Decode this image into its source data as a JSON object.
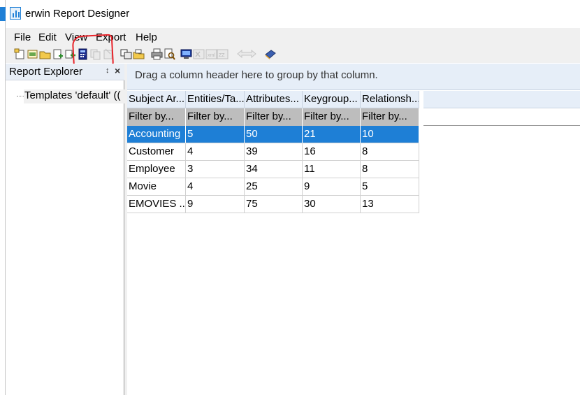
{
  "window": {
    "title": "erwin Report Designer"
  },
  "menu": [
    "File",
    "Edit",
    "View",
    "Export",
    "Help"
  ],
  "toolbar": {
    "icons": [
      "new-template-icon",
      "open-template-icon",
      "open-folder-icon",
      "add-document-icon",
      "add-green-icon",
      "calculator-icon",
      "copy-disabled-icon",
      "paste-disabled-icon",
      "copy-report-icon",
      "report-folder-icon",
      "print-icon",
      "print-preview-icon",
      "monitor-icon",
      "export-excel-disabled-icon",
      "export-xml-disabled-icon",
      "arrows-disabled-icon",
      "book-icon"
    ]
  },
  "left_panel": {
    "title": "Report Explorer",
    "pin_glyph": "↕",
    "close_glyph": "×",
    "tree_item": "Templates 'default' (("
  },
  "grid": {
    "group_hint": "Drag a column header here to group by that column.",
    "filter_text": "Filter by...",
    "columns": [
      "Subject Ar...",
      "Entities/Ta...",
      "Attributes...",
      "Keygroup...",
      "Relationsh..."
    ],
    "rows": [
      [
        "Accounting",
        "5",
        "50",
        "21",
        "10"
      ],
      [
        "Customer",
        "4",
        "39",
        "16",
        "8"
      ],
      [
        "Employee",
        "3",
        "34",
        "11",
        "8"
      ],
      [
        "Movie",
        "4",
        "25",
        "9",
        "5"
      ],
      [
        "EMOVIES ...",
        "9",
        "75",
        "30",
        "13"
      ]
    ],
    "selected_row": 0
  },
  "colors": {
    "selection": "#1e7fd6",
    "annotation": "#e8232a",
    "header_bg": "#e6eef8"
  }
}
